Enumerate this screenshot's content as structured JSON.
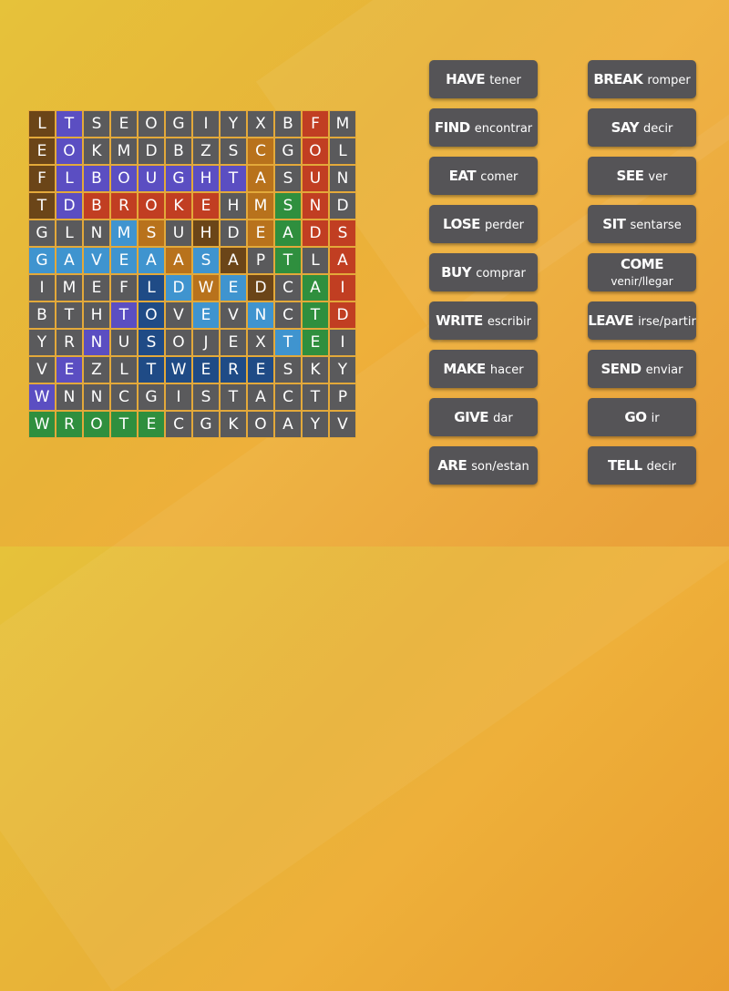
{
  "colors": {
    "cell_default": "#5a5a5c",
    "tile": "#555457",
    "purple": "#5b4ec2",
    "red": "#c13e22",
    "brown": "#6b4518",
    "orange": "#b8721c",
    "green": "#2f8f3e",
    "lightblue": "#3f94cf",
    "navy": "#1f4b86"
  },
  "grid": {
    "rows": [
      [
        "L",
        "T",
        "S",
        "E",
        "O",
        "G",
        "I",
        "Y",
        "X",
        "B",
        "F",
        "M"
      ],
      [
        "E",
        "O",
        "K",
        "M",
        "D",
        "B",
        "Z",
        "S",
        "C",
        "G",
        "O",
        "L"
      ],
      [
        "F",
        "L",
        "B",
        "O",
        "U",
        "G",
        "H",
        "T",
        "A",
        "S",
        "U",
        "N"
      ],
      [
        "T",
        "D",
        "B",
        "R",
        "O",
        "K",
        "E",
        "H",
        "M",
        "S",
        "N",
        "D"
      ],
      [
        "G",
        "L",
        "N",
        "M",
        "S",
        "U",
        "H",
        "D",
        "E",
        "A",
        "D",
        "S"
      ],
      [
        "G",
        "A",
        "V",
        "E",
        "A",
        "A",
        "S",
        "A",
        "P",
        "T",
        "L",
        "A"
      ],
      [
        "I",
        "M",
        "E",
        "F",
        "L",
        "D",
        "W",
        "E",
        "D",
        "C",
        "A",
        "I"
      ],
      [
        "B",
        "T",
        "H",
        "T",
        "O",
        "V",
        "E",
        "V",
        "N",
        "C",
        "T",
        "D"
      ],
      [
        "Y",
        "R",
        "N",
        "U",
        "S",
        "O",
        "J",
        "E",
        "X",
        "T",
        "E",
        "I"
      ],
      [
        "V",
        "E",
        "Z",
        "L",
        "T",
        "W",
        "E",
        "R",
        "E",
        "S",
        "K",
        "Y"
      ],
      [
        "W",
        "N",
        "N",
        "C",
        "G",
        "I",
        "S",
        "T",
        "A",
        "C",
        "T",
        "P"
      ],
      [
        "W",
        "R",
        "O",
        "T",
        "E",
        "C",
        "G",
        "K",
        "O",
        "A",
        "Y",
        "V"
      ]
    ],
    "highlights": [
      [
        "brown",
        "purple",
        "",
        "",
        "",
        "",
        "",
        "",
        "",
        "",
        "red",
        ""
      ],
      [
        "brown",
        "purple",
        "",
        "",
        "",
        "",
        "",
        "",
        "orange",
        "",
        "red",
        ""
      ],
      [
        "brown",
        "purple",
        "purple",
        "purple",
        "purple",
        "purple",
        "purple",
        "purple",
        "orange",
        "",
        "red",
        ""
      ],
      [
        "brown",
        "purple",
        "red",
        "red",
        "red",
        "red",
        "red",
        "",
        "orange",
        "green",
        "red",
        ""
      ],
      [
        "",
        "",
        "",
        "lightblue",
        "orange",
        "",
        "brown",
        "",
        "orange",
        "green",
        "red",
        "red"
      ],
      [
        "lightblue",
        "lightblue",
        "lightblue",
        "lightblue",
        "lightblue",
        "orange",
        "lightblue",
        "brown",
        "",
        "green",
        "",
        "red"
      ],
      [
        "",
        "",
        "",
        "",
        "navy",
        "lightblue",
        "orange",
        "lightblue",
        "brown",
        "",
        "green",
        "red"
      ],
      [
        "",
        "",
        "",
        "purple",
        "navy",
        "",
        "lightblue",
        "",
        "lightblue",
        "",
        "green",
        "red"
      ],
      [
        "",
        "",
        "purple",
        "",
        "navy",
        "",
        "",
        "",
        "",
        "lightblue",
        "green",
        ""
      ],
      [
        "",
        "purple",
        "",
        "",
        "navy",
        "navy",
        "navy",
        "navy",
        "navy",
        "",
        "",
        ""
      ],
      [
        "purple",
        "",
        "",
        "",
        "",
        "",
        "",
        "",
        "",
        "",
        "",
        ""
      ],
      [
        "green",
        "green",
        "green",
        "green",
        "green",
        "",
        "",
        "",
        "",
        "",
        "",
        ""
      ]
    ]
  },
  "words": {
    "left": [
      {
        "word": "HAVE",
        "translation": "tener"
      },
      {
        "word": "FIND",
        "translation": "encontrar"
      },
      {
        "word": "EAT",
        "translation": "comer"
      },
      {
        "word": "LOSE",
        "translation": "perder"
      },
      {
        "word": "BUY",
        "translation": "comprar"
      },
      {
        "word": "WRITE",
        "translation": "escribir"
      },
      {
        "word": "MAKE",
        "translation": "hacer"
      },
      {
        "word": "GIVE",
        "translation": "dar"
      },
      {
        "word": "ARE",
        "translation": "son/estan"
      }
    ],
    "right": [
      {
        "word": "BREAK",
        "translation": "romper"
      },
      {
        "word": "SAY",
        "translation": "decir"
      },
      {
        "word": "SEE",
        "translation": "ver"
      },
      {
        "word": "SIT",
        "translation": "sentarse"
      },
      {
        "word": "COME",
        "translation": "venir/llegar",
        "stacked": true
      },
      {
        "word": "LEAVE",
        "translation": "irse/partir"
      },
      {
        "word": "SEND",
        "translation": "enviar"
      },
      {
        "word": "GO",
        "translation": "ir"
      },
      {
        "word": "TELL",
        "translation": "decir"
      }
    ]
  }
}
